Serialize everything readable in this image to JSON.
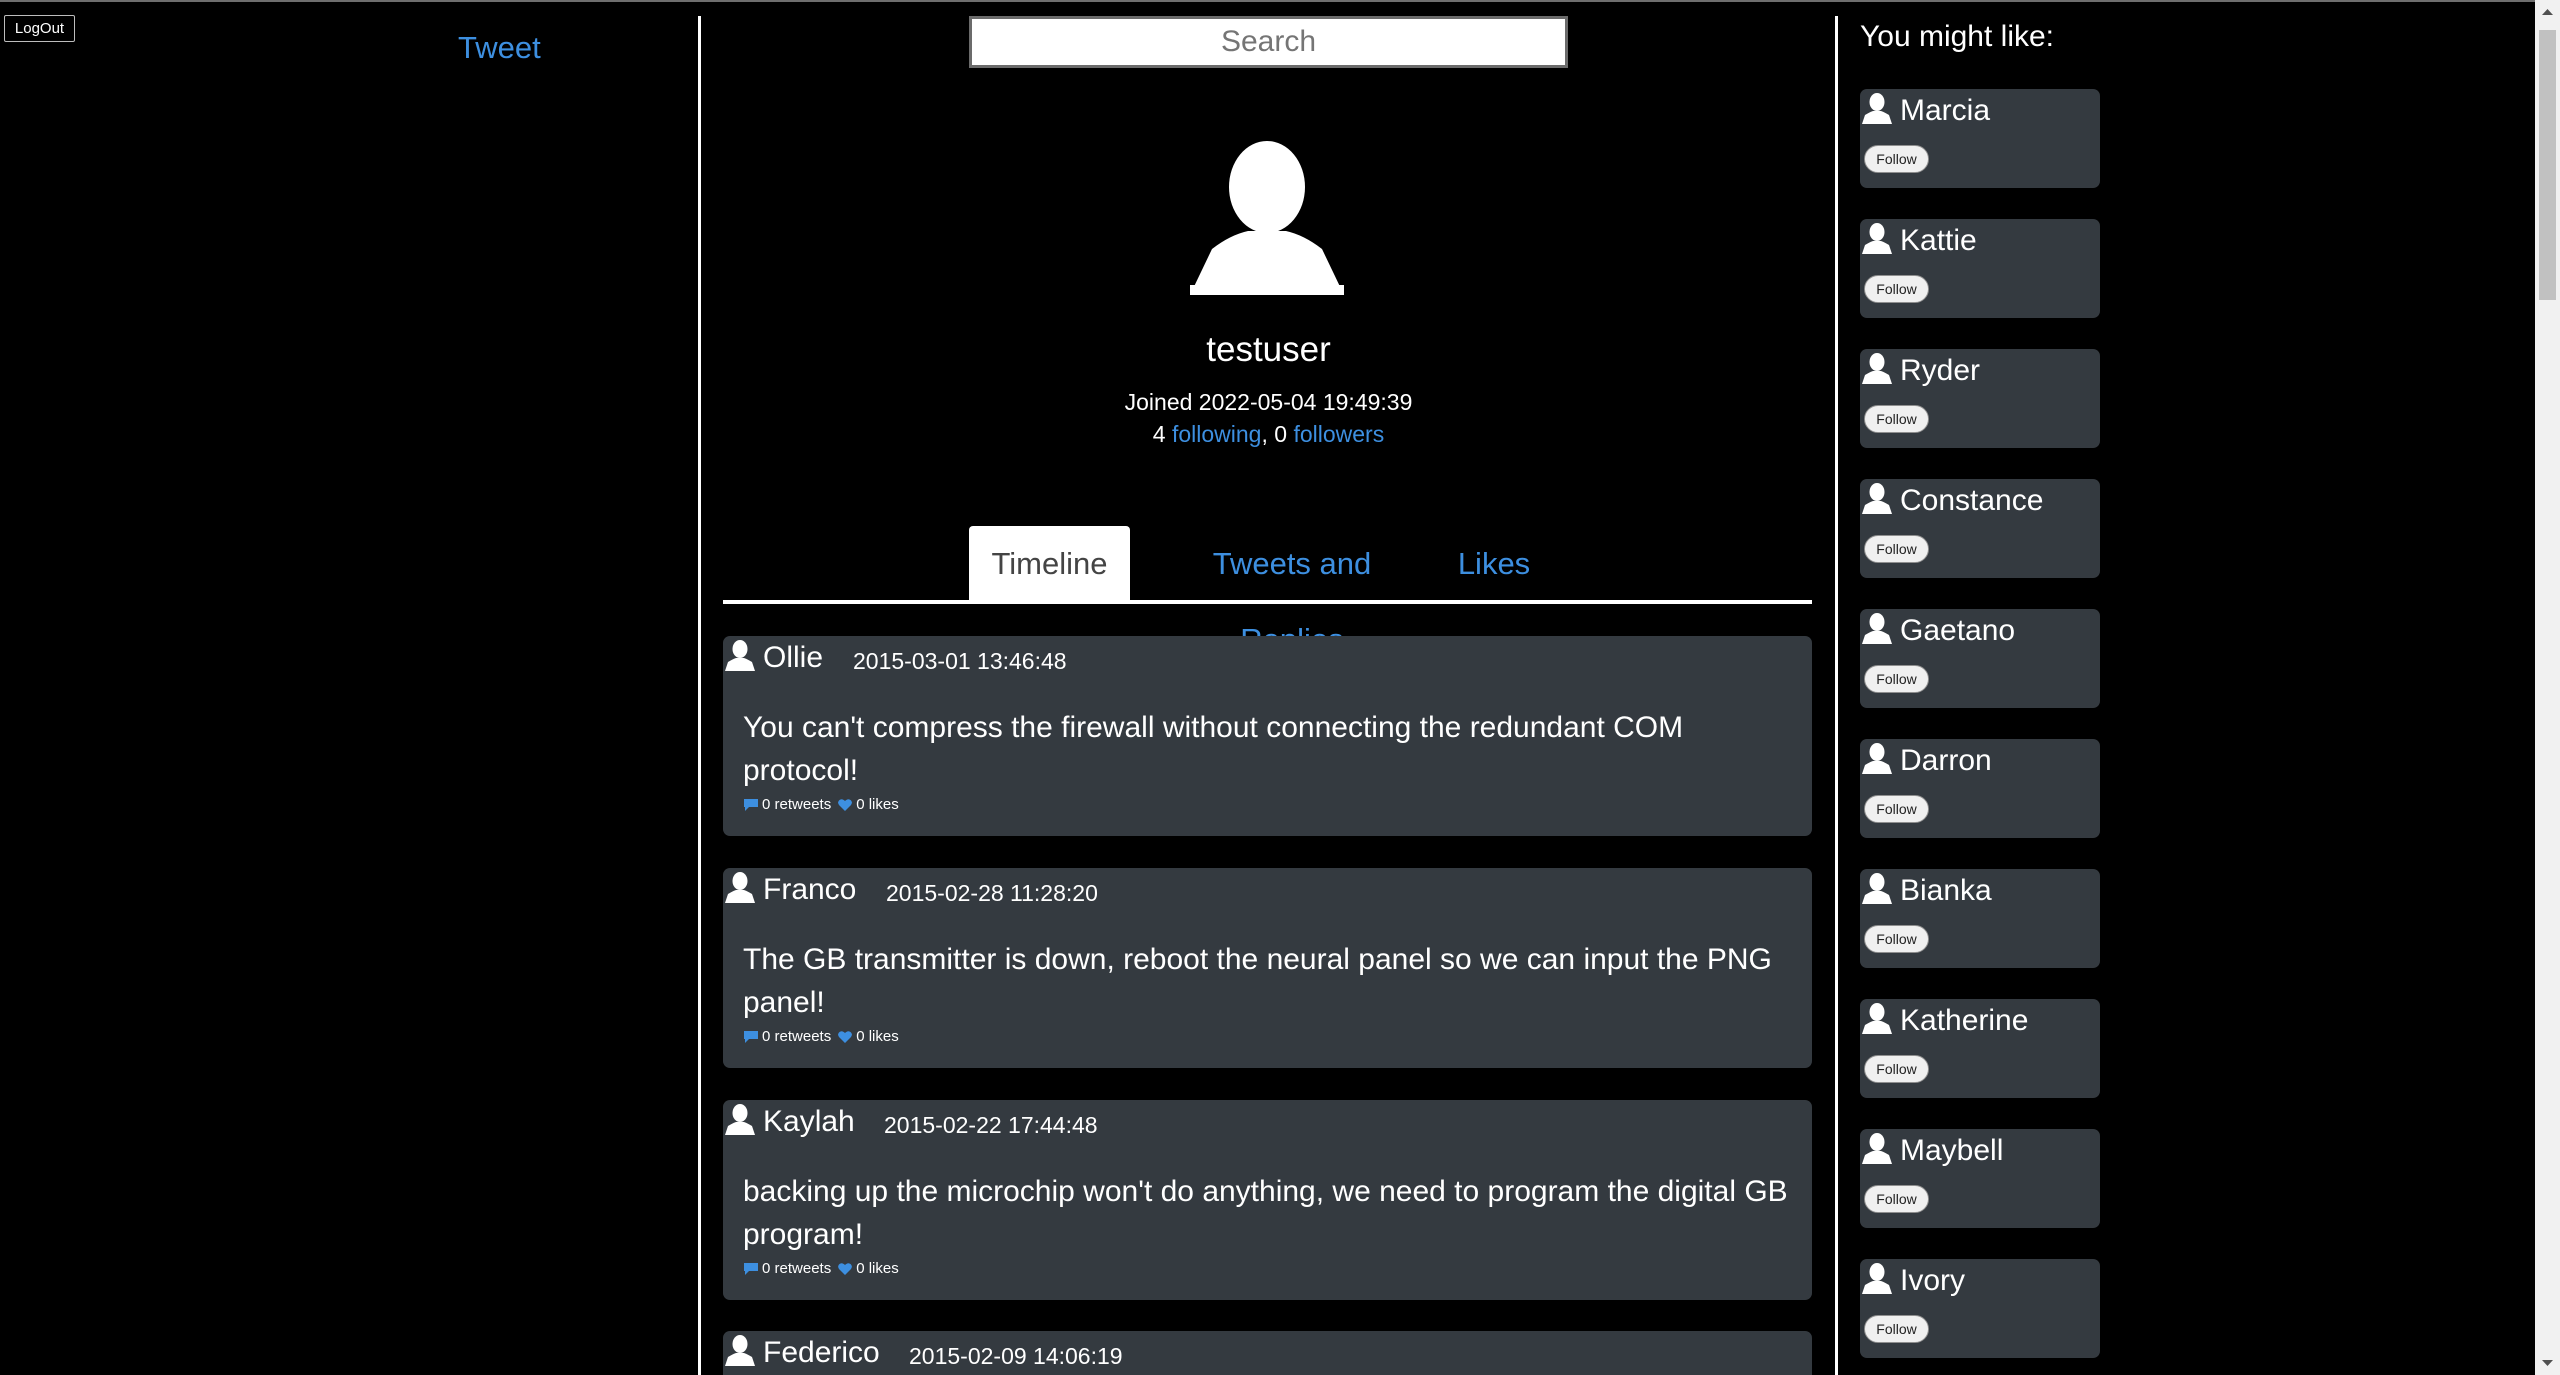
{
  "header": {
    "logout_label": "LogOut",
    "tweet_link": "Tweet",
    "search_placeholder": "Search"
  },
  "profile": {
    "username": "testuser",
    "joined": "Joined 2022-05-04 19:49:39",
    "following_count": "4",
    "following_label": "following",
    "separator": ",",
    "followers_count": "0",
    "followers_label": "followers"
  },
  "tabs": [
    {
      "label": "Timeline",
      "active": true
    },
    {
      "label": "Tweets and Replies",
      "active": false
    },
    {
      "label": "Likes",
      "active": false
    }
  ],
  "tweets": [
    {
      "author": "Ollie",
      "date": "2015-03-01 13:46:48",
      "text": "You can't compress the firewall without connecting the redundant COM protocol!",
      "retweets": "0 retweets",
      "likes": "0 likes"
    },
    {
      "author": "Franco",
      "date": "2015-02-28 11:28:20",
      "text": "The GB transmitter is down, reboot the neural panel so we can input the PNG panel!",
      "retweets": "0 retweets",
      "likes": "0 likes"
    },
    {
      "author": "Kaylah",
      "date": "2015-02-22 17:44:48",
      "text": "backing up the microchip won't do anything, we need to program the digital GB program!",
      "retweets": "0 retweets",
      "likes": "0 likes"
    },
    {
      "author": "Federico",
      "date": "2015-02-09 14:06:19",
      "text": "",
      "retweets": "",
      "likes": ""
    }
  ],
  "suggestions": {
    "heading": "You might like:",
    "follow_label": "Follow",
    "users": [
      "Marcia",
      "Kattie",
      "Ryder",
      "Constance",
      "Gaetano",
      "Darron",
      "Bianka",
      "Katherine",
      "Maybell",
      "Ivory"
    ]
  },
  "colors": {
    "background": "#000000",
    "card": "#343a40",
    "link": "#3d8fe0",
    "text": "#ffffff"
  },
  "icons": {
    "avatar": "user-silhouette-icon",
    "retweet": "speech-bubble-icon",
    "like": "heart-icon"
  }
}
